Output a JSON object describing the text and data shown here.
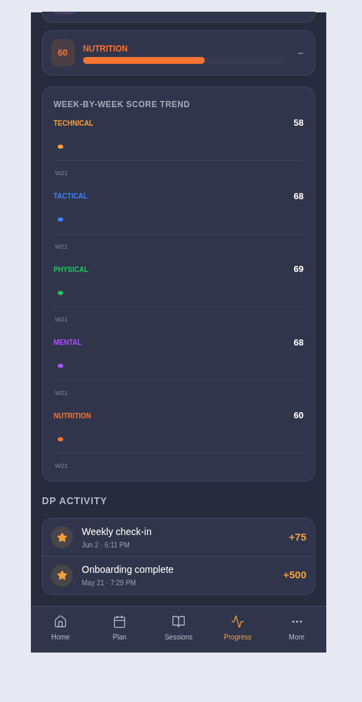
{
  "pillar_card": {
    "score": "60",
    "name": "NUTRITION",
    "level": 0.6,
    "color": "#f97333",
    "trend": "–"
  },
  "trend": {
    "title": "WEEK-BY-WEEK SCORE TREND",
    "metrics": [
      {
        "name": "TECHNICAL",
        "score": "58",
        "color": "#f5a03a",
        "week": "W21"
      },
      {
        "name": "TACTICAL",
        "score": "68",
        "color": "#3b82f6",
        "week": "W21"
      },
      {
        "name": "PHYSICAL",
        "score": "69",
        "color": "#22c55e",
        "week": "W21"
      },
      {
        "name": "MENTAL",
        "score": "68",
        "color": "#a855f7",
        "week": "W21"
      },
      {
        "name": "NUTRITION",
        "score": "60",
        "color": "#f97333",
        "week": "W21"
      }
    ]
  },
  "activity": {
    "title": "DP ACTIVITY",
    "items": [
      {
        "title": "Weekly check-in",
        "time": "Jun 2 · 6:11 PM",
        "points": "+75"
      },
      {
        "title": "Onboarding complete",
        "time": "May 21 · 7:29 PM",
        "points": "+500"
      }
    ]
  },
  "nav": [
    {
      "kind": "home",
      "label": "Home",
      "selected": false
    },
    {
      "kind": "plan",
      "label": "Plan",
      "selected": false
    },
    {
      "kind": "sessions",
      "label": "Sessions",
      "selected": false
    },
    {
      "kind": "progress",
      "label": "Progress",
      "selected": true
    },
    {
      "kind": "more",
      "label": "More",
      "selected": false
    }
  ]
}
